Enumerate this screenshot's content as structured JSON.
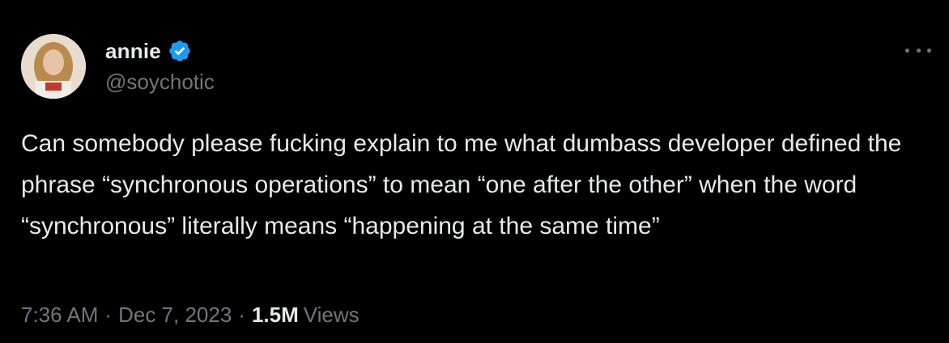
{
  "author": {
    "display_name": "annie",
    "handle": "@soychotic",
    "verified": true,
    "avatar": "profile-photo"
  },
  "tweet": {
    "text": "Can somebody please fucking explain to me what dumbass developer defined the phrase “synchronous operations” to mean “one after the other” when the word “synchronous” literally means “happening at the same time”"
  },
  "meta": {
    "time": "7:36 AM",
    "separator": "·",
    "date": "Dec 7, 2023",
    "views_count": "1.5M",
    "views_label": "Views"
  },
  "icons": {
    "verified": "verified-badge-icon",
    "more": "more-options-icon"
  },
  "colors": {
    "background": "#000000",
    "text": "#e7e9ea",
    "muted": "#71767b",
    "verified": "#1d9bf0"
  }
}
